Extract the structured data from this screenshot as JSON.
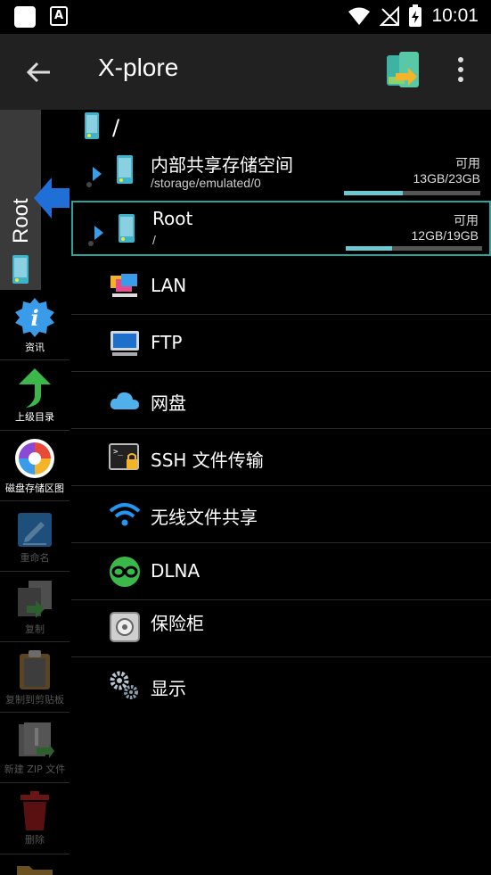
{
  "status_bar": {
    "time": "10:01"
  },
  "app_bar": {
    "title": "X-plore"
  },
  "side_tab": {
    "label": "Root"
  },
  "toolbar": [
    {
      "label": "资讯",
      "icon": "info-icon",
      "enabled": true
    },
    {
      "label": "上级目录",
      "icon": "up-arrow-icon",
      "enabled": true
    },
    {
      "label": "磁盘存储区图",
      "icon": "disk-map-icon",
      "enabled": true
    },
    {
      "label": "重命名",
      "icon": "rename-icon",
      "enabled": false
    },
    {
      "label": "复制",
      "icon": "copy-icon",
      "enabled": false
    },
    {
      "label": "复制到剪贴板",
      "icon": "clipboard-icon",
      "enabled": false
    },
    {
      "label": "新建 ZIP 文件",
      "icon": "zip-icon",
      "enabled": false
    },
    {
      "label": "删除",
      "icon": "trash-icon",
      "enabled": false
    }
  ],
  "path": {
    "text": "/"
  },
  "drives": [
    {
      "name": "内部共享存储空间",
      "path": "/storage/emulated/0",
      "avail_label": "可用",
      "size": "13GB/23GB",
      "used_fraction": 0.43,
      "selected": false
    },
    {
      "name": "Root",
      "path": "/",
      "avail_label": "可用",
      "size": "12GB/19GB",
      "used_fraction": 0.34,
      "selected": true
    }
  ],
  "entries": [
    {
      "label": "LAN",
      "icon": "lan-icon"
    },
    {
      "label": "FTP",
      "icon": "ftp-icon"
    },
    {
      "label": "网盘",
      "icon": "cloud-icon"
    },
    {
      "label": "SSH 文件传输",
      "icon": "ssh-icon"
    },
    {
      "label": "无线文件共享",
      "icon": "wifi-icon"
    },
    {
      "label": "DLNA",
      "icon": "dlna-icon"
    },
    {
      "label": "保险柜",
      "icon": "vault-icon"
    },
    {
      "label": "显示",
      "icon": "settings-icon"
    }
  ],
  "colors": {
    "accent": "#2aa39b",
    "appbar": "#212121",
    "bar_fill": "#6cc7cf"
  }
}
